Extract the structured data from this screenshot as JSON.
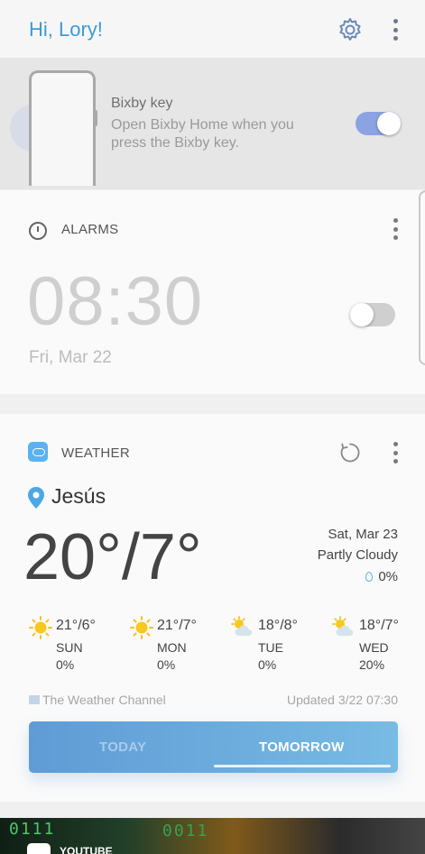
{
  "header": {
    "greeting": "Hi, Lory!"
  },
  "bixby": {
    "title": "Bixby key",
    "description": "Open Bixby Home when you press the Bixby key.",
    "enabled": true
  },
  "alarms": {
    "title": "ALARMS",
    "time": "08:30",
    "date": "Fri, Mar 22",
    "enabled": false
  },
  "weather": {
    "title": "WEATHER",
    "location": "Jesús",
    "high_low": "20°/7°",
    "date": "Sat, Mar 23",
    "condition": "Partly Cloudy",
    "precip": "0%",
    "forecast": [
      {
        "temp": "21°/6°",
        "day": "SUN",
        "precip": "0%",
        "icon": "sunny-icon"
      },
      {
        "temp": "21°/7°",
        "day": "MON",
        "precip": "0%",
        "icon": "sunny-icon"
      },
      {
        "temp": "18°/8°",
        "day": "TUE",
        "precip": "0%",
        "icon": "partly-cloudy-icon"
      },
      {
        "temp": "18°/7°",
        "day": "WED",
        "precip": "20%",
        "icon": "partly-cloudy-icon"
      }
    ],
    "provider": "The Weather Channel",
    "updated": "Updated 3/22 07:30",
    "tabs": {
      "today": "TODAY",
      "tomorrow": "TOMORROW",
      "selected": "tomorrow"
    }
  },
  "banner": {
    "label": "YOUTUBE"
  },
  "colors": {
    "accent": "#3d9ad8",
    "toggle_on": "#8ba3e3",
    "tab_gradient_start": "#5f9bd5",
    "tab_gradient_end": "#78bbe4"
  }
}
